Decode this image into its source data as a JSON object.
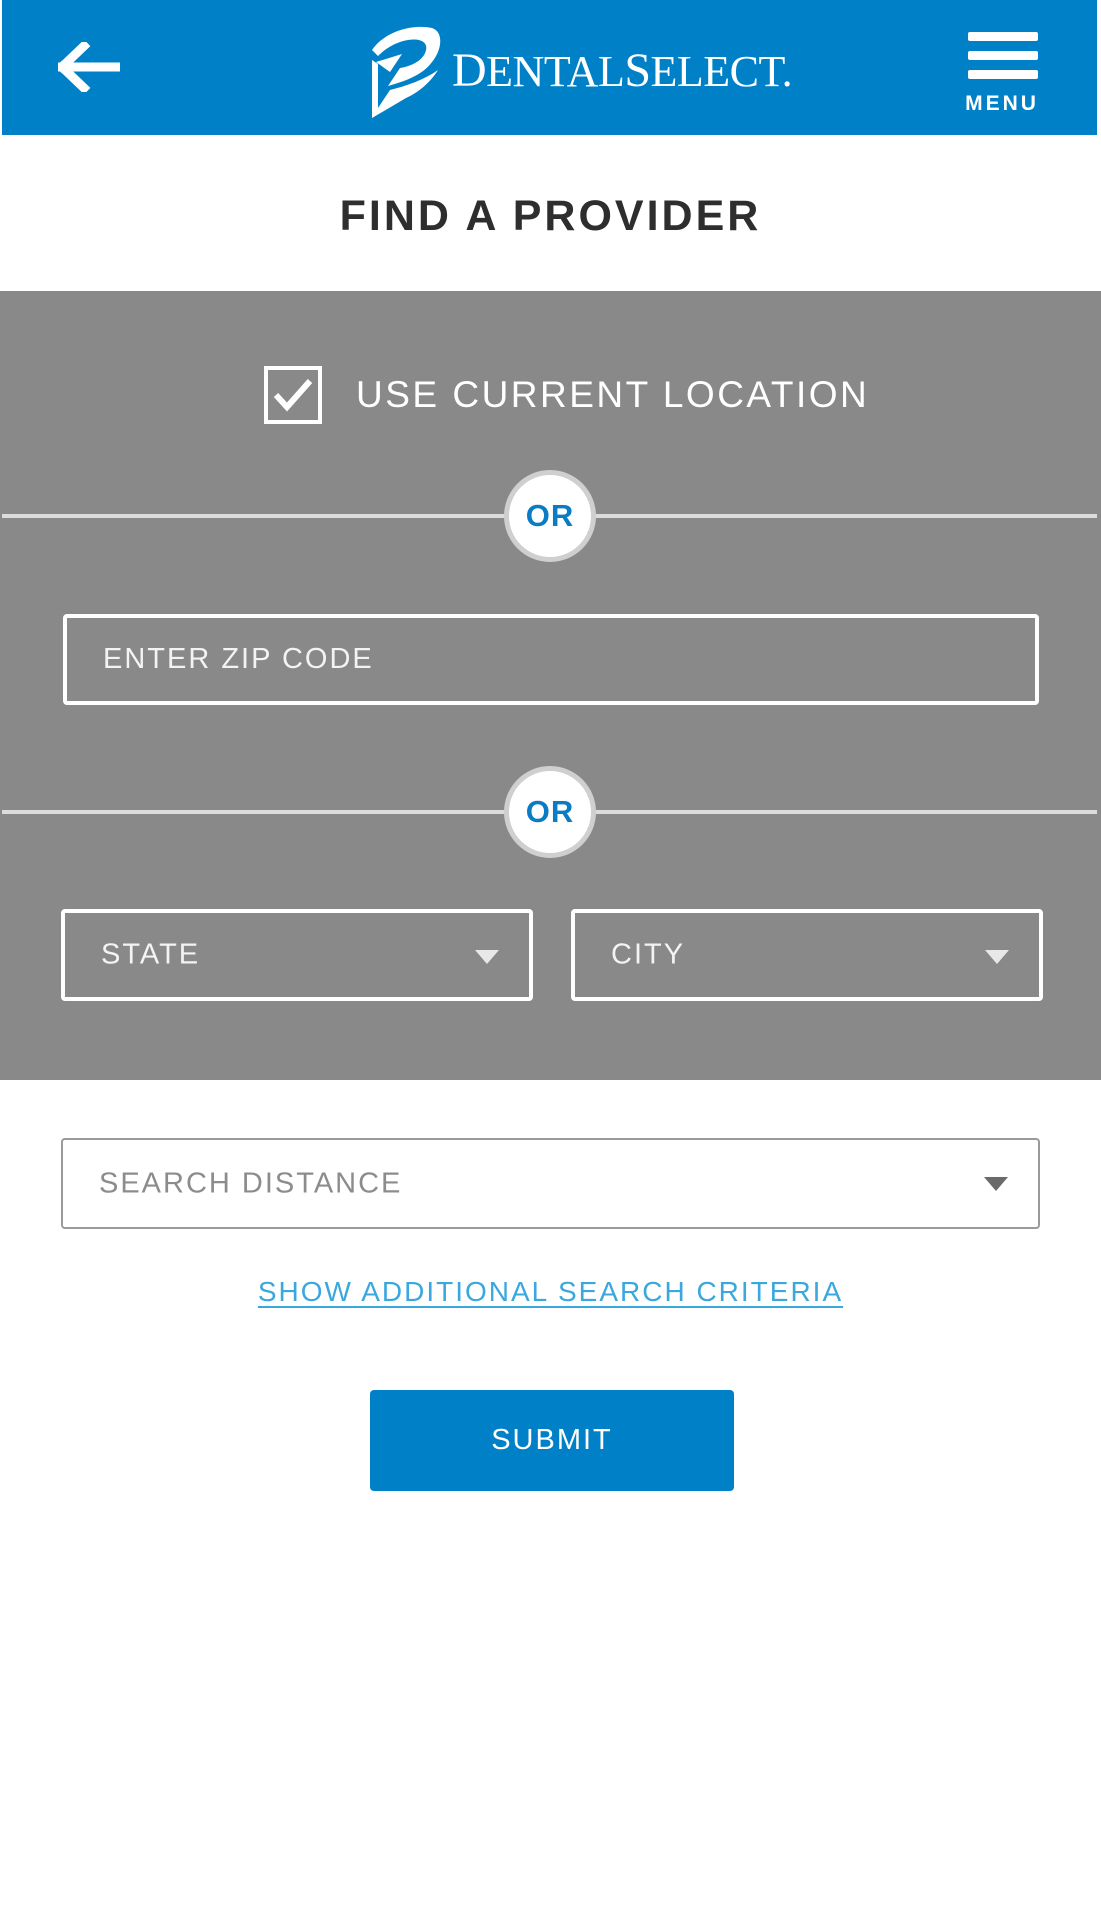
{
  "header": {
    "background_color": "#0080c7",
    "back_icon": "arrow-left-icon",
    "logo": {
      "text_initial_1": "D",
      "text_rest_1": "ENTAL",
      "text_initial_2": "S",
      "text_rest_2": "ELECT",
      "trademark": "."
    },
    "menu_icon": "hamburger-menu-icon",
    "menu_label": "MENU"
  },
  "page": {
    "title": "FIND A PROVIDER"
  },
  "search_panel": {
    "background_color": "#898989",
    "use_current_location": {
      "checked": true,
      "label": "USE CURRENT LOCATION"
    },
    "or_label_1": "OR",
    "zip_code": {
      "value": "",
      "placeholder": "ENTER ZIP CODE"
    },
    "or_label_2": "OR",
    "state_select": {
      "selected": "STATE"
    },
    "city_select": {
      "selected": "CITY"
    }
  },
  "search_distance": {
    "selected": "SEARCH DISTANCE"
  },
  "additional_criteria_link": "SHOW ADDITIONAL SEARCH CRITERIA",
  "submit_label": "SUBMIT",
  "colors": {
    "accent": "#0080c7",
    "or_text": "#0a7cc4",
    "link": "#3aa8df"
  }
}
